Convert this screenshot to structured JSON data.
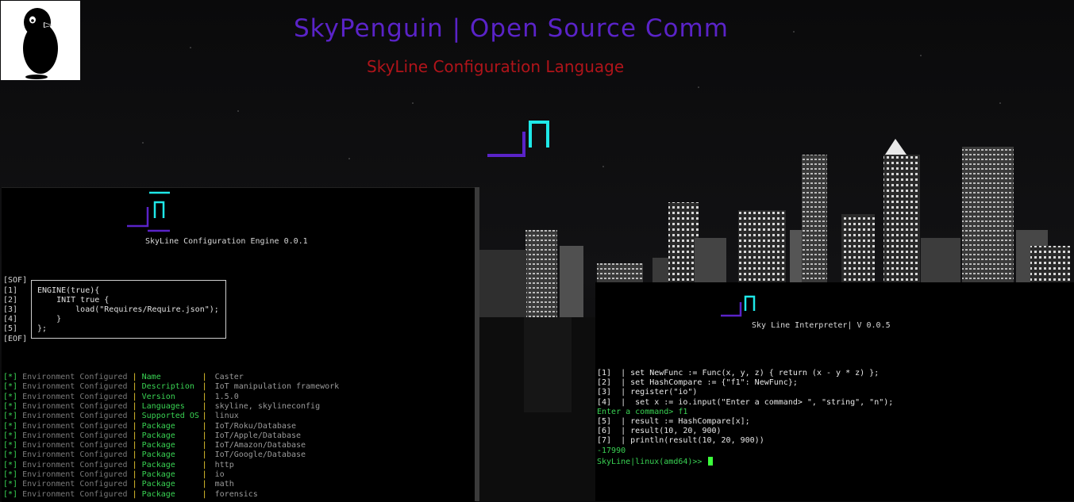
{
  "header": {
    "title": "SkyPenguin | Open Source Comm",
    "subtitle": "SkyLine Configuration Language"
  },
  "colors": {
    "title": "#5a23c8",
    "subtitle": "#b0141a",
    "accent_cyan": "#1ee8e8",
    "accent_purple": "#5a23c8",
    "term_green": "#39d353",
    "term_yellow": "#f0d030"
  },
  "icons": {
    "logo": "penguin-logo-icon",
    "brand": "skyline-mark-icon"
  },
  "engine": {
    "title": "SkyLine Configuration Engine 0.0.1",
    "sof": "[SOF]",
    "eof": "[EOF]",
    "line_numbers": [
      "[1]",
      "[2]",
      "[3]",
      "[4]",
      "[5]"
    ],
    "code": [
      "ENGINE(true){",
      "    INIT true {",
      "        load(\"Requires/Require.json\");",
      "    }",
      "};"
    ],
    "status_label": "[*]",
    "status_text": "Environment Configured",
    "separator": "|",
    "rows": [
      {
        "key": "Name",
        "value": "Caster"
      },
      {
        "key": "Description",
        "value": "IoT manipulation framework"
      },
      {
        "key": "Version",
        "value": "1.5.0"
      },
      {
        "key": "Languages",
        "value": "skyline, skylineconfig"
      },
      {
        "key": "Supported OS",
        "value": "linux"
      },
      {
        "key": "Package",
        "value": "IoT/Roku/Database"
      },
      {
        "key": "Package",
        "value": "IoT/Apple/Database"
      },
      {
        "key": "Package",
        "value": "IoT/Amazon/Database"
      },
      {
        "key": "Package",
        "value": "IoT/Google/Database"
      },
      {
        "key": "Package",
        "value": "http"
      },
      {
        "key": "Package",
        "value": "io"
      },
      {
        "key": "Package",
        "value": "math"
      },
      {
        "key": "Package",
        "value": "forensics"
      }
    ]
  },
  "interpreter": {
    "title": "Sky Line Interpreter| V 0.0.5",
    "lines": [
      {
        "text": "[1]  | set NewFunc := Func(x, y, z) { return (x - y * z) };",
        "green": false
      },
      {
        "text": "[2]  | set HashCompare := {\"f1\": NewFunc};",
        "green": false
      },
      {
        "text": "[3]  | register(\"io\")",
        "green": false
      },
      {
        "text": "[4]  |  set x := io.input(\"Enter a command> \", \"string\", \"n\");",
        "green": false
      },
      {
        "text": "Enter a command> f1",
        "green": true
      },
      {
        "text": "[5]  | result := HashCompare[x];",
        "green": false
      },
      {
        "text": "[6]  | result(10, 20, 900)",
        "green": false
      },
      {
        "text": "[7]  | println(result(10, 20, 900))",
        "green": false
      },
      {
        "text": "-17990",
        "green": true
      }
    ],
    "prompt": "SkyLine|linux(amd64)>> "
  }
}
